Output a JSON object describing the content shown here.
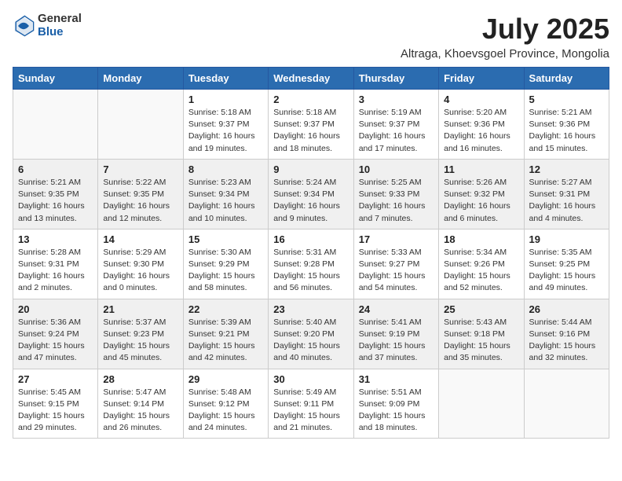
{
  "header": {
    "logo_general": "General",
    "logo_blue": "Blue",
    "title": "July 2025",
    "subtitle": "Altraga, Khoevsgoel Province, Mongolia"
  },
  "calendar": {
    "days_of_week": [
      "Sunday",
      "Monday",
      "Tuesday",
      "Wednesday",
      "Thursday",
      "Friday",
      "Saturday"
    ],
    "weeks": [
      [
        {
          "day": "",
          "info": ""
        },
        {
          "day": "",
          "info": ""
        },
        {
          "day": "1",
          "info": "Sunrise: 5:18 AM\nSunset: 9:37 PM\nDaylight: 16 hours\nand 19 minutes."
        },
        {
          "day": "2",
          "info": "Sunrise: 5:18 AM\nSunset: 9:37 PM\nDaylight: 16 hours\nand 18 minutes."
        },
        {
          "day": "3",
          "info": "Sunrise: 5:19 AM\nSunset: 9:37 PM\nDaylight: 16 hours\nand 17 minutes."
        },
        {
          "day": "4",
          "info": "Sunrise: 5:20 AM\nSunset: 9:36 PM\nDaylight: 16 hours\nand 16 minutes."
        },
        {
          "day": "5",
          "info": "Sunrise: 5:21 AM\nSunset: 9:36 PM\nDaylight: 16 hours\nand 15 minutes."
        }
      ],
      [
        {
          "day": "6",
          "info": "Sunrise: 5:21 AM\nSunset: 9:35 PM\nDaylight: 16 hours\nand 13 minutes."
        },
        {
          "day": "7",
          "info": "Sunrise: 5:22 AM\nSunset: 9:35 PM\nDaylight: 16 hours\nand 12 minutes."
        },
        {
          "day": "8",
          "info": "Sunrise: 5:23 AM\nSunset: 9:34 PM\nDaylight: 16 hours\nand 10 minutes."
        },
        {
          "day": "9",
          "info": "Sunrise: 5:24 AM\nSunset: 9:34 PM\nDaylight: 16 hours\nand 9 minutes."
        },
        {
          "day": "10",
          "info": "Sunrise: 5:25 AM\nSunset: 9:33 PM\nDaylight: 16 hours\nand 7 minutes."
        },
        {
          "day": "11",
          "info": "Sunrise: 5:26 AM\nSunset: 9:32 PM\nDaylight: 16 hours\nand 6 minutes."
        },
        {
          "day": "12",
          "info": "Sunrise: 5:27 AM\nSunset: 9:31 PM\nDaylight: 16 hours\nand 4 minutes."
        }
      ],
      [
        {
          "day": "13",
          "info": "Sunrise: 5:28 AM\nSunset: 9:31 PM\nDaylight: 16 hours\nand 2 minutes."
        },
        {
          "day": "14",
          "info": "Sunrise: 5:29 AM\nSunset: 9:30 PM\nDaylight: 16 hours\nand 0 minutes."
        },
        {
          "day": "15",
          "info": "Sunrise: 5:30 AM\nSunset: 9:29 PM\nDaylight: 15 hours\nand 58 minutes."
        },
        {
          "day": "16",
          "info": "Sunrise: 5:31 AM\nSunset: 9:28 PM\nDaylight: 15 hours\nand 56 minutes."
        },
        {
          "day": "17",
          "info": "Sunrise: 5:33 AM\nSunset: 9:27 PM\nDaylight: 15 hours\nand 54 minutes."
        },
        {
          "day": "18",
          "info": "Sunrise: 5:34 AM\nSunset: 9:26 PM\nDaylight: 15 hours\nand 52 minutes."
        },
        {
          "day": "19",
          "info": "Sunrise: 5:35 AM\nSunset: 9:25 PM\nDaylight: 15 hours\nand 49 minutes."
        }
      ],
      [
        {
          "day": "20",
          "info": "Sunrise: 5:36 AM\nSunset: 9:24 PM\nDaylight: 15 hours\nand 47 minutes."
        },
        {
          "day": "21",
          "info": "Sunrise: 5:37 AM\nSunset: 9:23 PM\nDaylight: 15 hours\nand 45 minutes."
        },
        {
          "day": "22",
          "info": "Sunrise: 5:39 AM\nSunset: 9:21 PM\nDaylight: 15 hours\nand 42 minutes."
        },
        {
          "day": "23",
          "info": "Sunrise: 5:40 AM\nSunset: 9:20 PM\nDaylight: 15 hours\nand 40 minutes."
        },
        {
          "day": "24",
          "info": "Sunrise: 5:41 AM\nSunset: 9:19 PM\nDaylight: 15 hours\nand 37 minutes."
        },
        {
          "day": "25",
          "info": "Sunrise: 5:43 AM\nSunset: 9:18 PM\nDaylight: 15 hours\nand 35 minutes."
        },
        {
          "day": "26",
          "info": "Sunrise: 5:44 AM\nSunset: 9:16 PM\nDaylight: 15 hours\nand 32 minutes."
        }
      ],
      [
        {
          "day": "27",
          "info": "Sunrise: 5:45 AM\nSunset: 9:15 PM\nDaylight: 15 hours\nand 29 minutes."
        },
        {
          "day": "28",
          "info": "Sunrise: 5:47 AM\nSunset: 9:14 PM\nDaylight: 15 hours\nand 26 minutes."
        },
        {
          "day": "29",
          "info": "Sunrise: 5:48 AM\nSunset: 9:12 PM\nDaylight: 15 hours\nand 24 minutes."
        },
        {
          "day": "30",
          "info": "Sunrise: 5:49 AM\nSunset: 9:11 PM\nDaylight: 15 hours\nand 21 minutes."
        },
        {
          "day": "31",
          "info": "Sunrise: 5:51 AM\nSunset: 9:09 PM\nDaylight: 15 hours\nand 18 minutes."
        },
        {
          "day": "",
          "info": ""
        },
        {
          "day": "",
          "info": ""
        }
      ]
    ]
  }
}
